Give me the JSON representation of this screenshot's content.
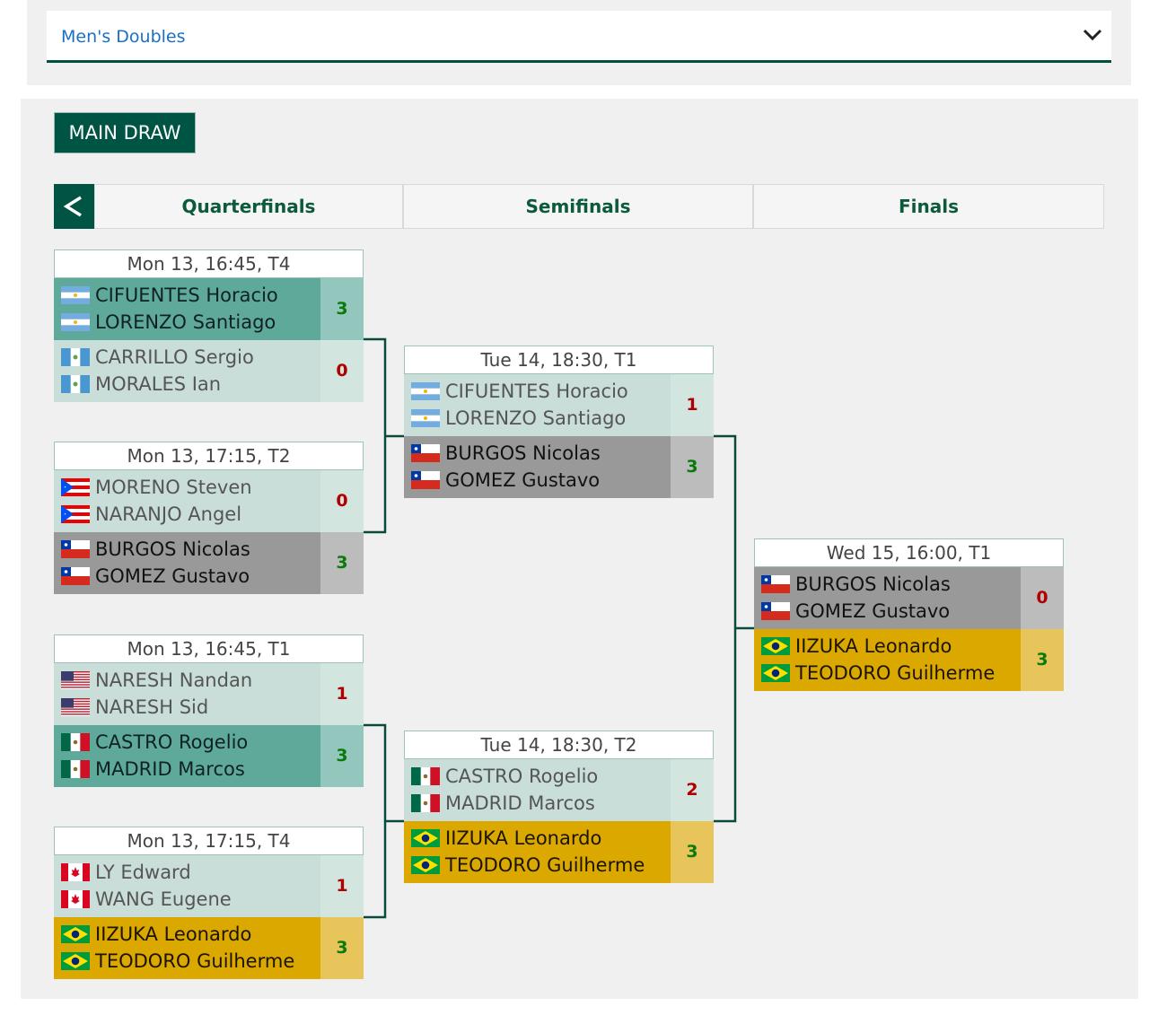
{
  "event_select": {
    "value": "Men's Doubles"
  },
  "tabs": {
    "main_draw": "MAIN DRAW"
  },
  "rounds": {
    "back": "<",
    "items": [
      "Quarterfinals",
      "Semifinals",
      "Finals"
    ]
  },
  "matches": [
    {
      "header": "Mon 13, 16:45, T4",
      "teams": [
        {
          "players": [
            {
              "flag": "ARG",
              "name": "CIFUENTES Horacio"
            },
            {
              "flag": "ARG",
              "name": "LORENZO Santiago"
            }
          ],
          "score": "3",
          "state": "winner"
        },
        {
          "players": [
            {
              "flag": "GUA",
              "name": "CARRILLO Sergio"
            },
            {
              "flag": "GUA",
              "name": "MORALES Ian"
            }
          ],
          "score": "0",
          "state": "loser"
        }
      ]
    },
    {
      "header": "Mon 13, 17:15, T2",
      "teams": [
        {
          "players": [
            {
              "flag": "PUR",
              "name": "MORENO Steven"
            },
            {
              "flag": "PUR",
              "name": "NARANJO Angel"
            }
          ],
          "score": "0",
          "state": "loser"
        },
        {
          "players": [
            {
              "flag": "CHI",
              "name": "BURGOS Nicolas"
            },
            {
              "flag": "CHI",
              "name": "GOMEZ Gustavo"
            }
          ],
          "score": "3",
          "state": "grey"
        }
      ]
    },
    {
      "header": "Mon 13, 16:45, T1",
      "teams": [
        {
          "players": [
            {
              "flag": "USA",
              "name": "NARESH Nandan"
            },
            {
              "flag": "USA",
              "name": "NARESH Sid"
            }
          ],
          "score": "1",
          "state": "loser"
        },
        {
          "players": [
            {
              "flag": "MEX",
              "name": "CASTRO Rogelio"
            },
            {
              "flag": "MEX",
              "name": "MADRID Marcos"
            }
          ],
          "score": "3",
          "state": "winner"
        }
      ]
    },
    {
      "header": "Mon 13, 17:15, T4",
      "teams": [
        {
          "players": [
            {
              "flag": "CAN",
              "name": "LY Edward"
            },
            {
              "flag": "CAN",
              "name": "WANG Eugene"
            }
          ],
          "score": "1",
          "state": "loser"
        },
        {
          "players": [
            {
              "flag": "BRA",
              "name": "IIZUKA Leonardo"
            },
            {
              "flag": "BRA",
              "name": "TEODORO Guilherme"
            }
          ],
          "score": "3",
          "state": "gold"
        }
      ]
    },
    {
      "header": "Tue 14, 18:30, T1",
      "teams": [
        {
          "players": [
            {
              "flag": "ARG",
              "name": "CIFUENTES Horacio"
            },
            {
              "flag": "ARG",
              "name": "LORENZO Santiago"
            }
          ],
          "score": "1",
          "state": "loser"
        },
        {
          "players": [
            {
              "flag": "CHI",
              "name": "BURGOS Nicolas"
            },
            {
              "flag": "CHI",
              "name": "GOMEZ Gustavo"
            }
          ],
          "score": "3",
          "state": "grey"
        }
      ]
    },
    {
      "header": "Tue 14, 18:30, T2",
      "teams": [
        {
          "players": [
            {
              "flag": "MEX",
              "name": "CASTRO Rogelio"
            },
            {
              "flag": "MEX",
              "name": "MADRID Marcos"
            }
          ],
          "score": "2",
          "state": "loser"
        },
        {
          "players": [
            {
              "flag": "BRA",
              "name": "IIZUKA Leonardo"
            },
            {
              "flag": "BRA",
              "name": "TEODORO Guilherme"
            }
          ],
          "score": "3",
          "state": "gold"
        }
      ]
    },
    {
      "header": "Wed 15, 16:00, T1",
      "teams": [
        {
          "players": [
            {
              "flag": "CHI",
              "name": "BURGOS Nicolas"
            },
            {
              "flag": "CHI",
              "name": "GOMEZ Gustavo"
            }
          ],
          "score": "0",
          "state": "grey-loser"
        },
        {
          "players": [
            {
              "flag": "BRA",
              "name": "IIZUKA Leonardo"
            },
            {
              "flag": "BRA",
              "name": "TEODORO Guilherme"
            }
          ],
          "score": "3",
          "state": "gold"
        }
      ]
    }
  ],
  "colors": {
    "brand": "#005444",
    "link": "#1a6fc7",
    "win_score": "#0a7a0a",
    "lose_score": "#b00000"
  }
}
